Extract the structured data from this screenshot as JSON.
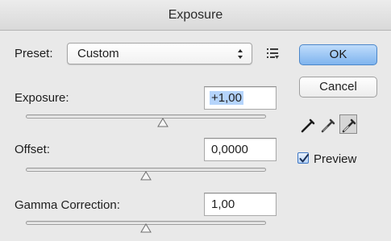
{
  "window": {
    "title": "Exposure"
  },
  "preset": {
    "label": "Preset:",
    "value": "Custom",
    "menu_icon": "list-menu-icon",
    "stepper_icon": "up-down-arrows-icon"
  },
  "exposure": {
    "label": "Exposure:",
    "value": "+1,00",
    "slider_position": 0.57
  },
  "offset": {
    "label": "Offset:",
    "value": "0,0000",
    "slider_position": 0.5
  },
  "gamma": {
    "label": "Gamma Correction:",
    "value": "1,00",
    "slider_position": 0.5
  },
  "buttons": {
    "ok_label": "OK",
    "cancel_label": "Cancel"
  },
  "eyedroppers": [
    {
      "name": "black-point-eyedropper-icon",
      "selected": false
    },
    {
      "name": "gray-point-eyedropper-icon",
      "selected": false
    },
    {
      "name": "white-point-eyedropper-icon",
      "selected": true
    }
  ],
  "preview": {
    "label": "Preview",
    "checked": true
  },
  "colors": {
    "ok_button": "#8ebcf2",
    "selection_highlight": "#b5d4fb",
    "checkbox": "#3f77c4"
  }
}
